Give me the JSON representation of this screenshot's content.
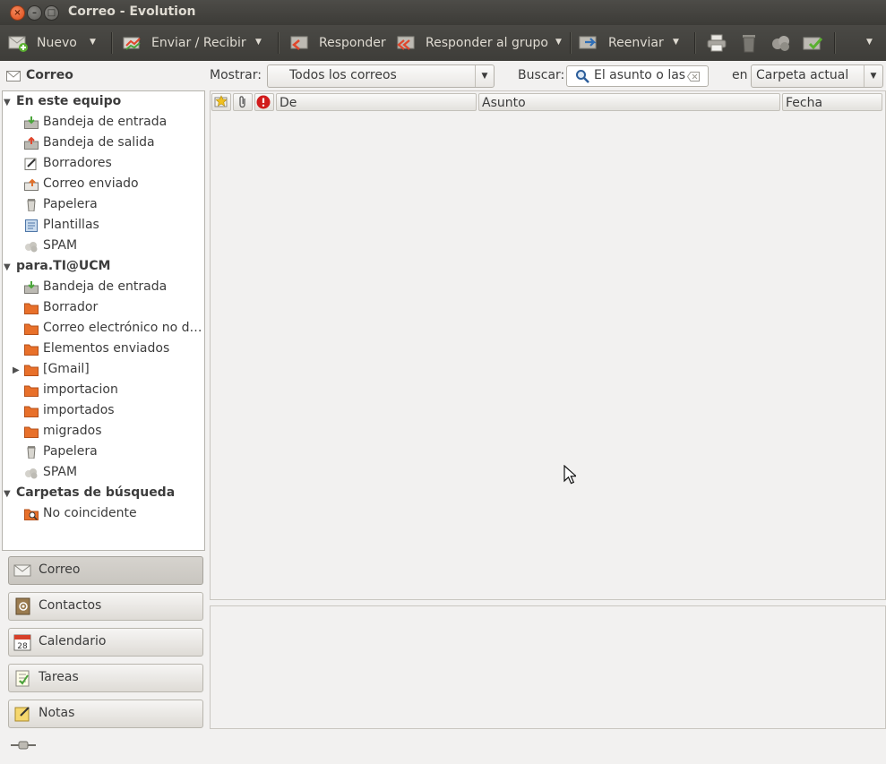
{
  "window": {
    "title": "Correo - Evolution"
  },
  "toolbar": {
    "new_label": "Nuevo",
    "send_receive_label": "Enviar / Recibir",
    "reply_label": "Responder",
    "reply_group_label": "Responder al grupo",
    "forward_label": "Reenviar"
  },
  "sidebar": {
    "header_title": "Correo",
    "groups": [
      {
        "name": "En este equipo",
        "folders": [
          "Bandeja de entrada",
          "Bandeja de salida",
          "Borradores",
          "Correo enviado",
          "Papelera",
          "Plantillas",
          "SPAM"
        ]
      },
      {
        "name": "para.TI@UCM",
        "folders": [
          "Bandeja de entrada",
          "Borrador",
          "Correo electrónico no d…",
          "Elementos enviados",
          "[Gmail]",
          "importacion",
          "importados",
          "migrados",
          "Papelera",
          "SPAM"
        ]
      },
      {
        "name": "Carpetas de búsqueda",
        "folders": [
          "No coincidente"
        ]
      }
    ]
  },
  "switcher": {
    "mail": "Correo",
    "contacts": "Contactos",
    "calendar": "Calendario",
    "calendar_day": "28",
    "tasks": "Tareas",
    "notes": "Notas"
  },
  "searchbar": {
    "show_label": "Mostrar:",
    "show_value": "Todos los correos",
    "search_label": "Buscar:",
    "search_placeholder": "El asunto o las",
    "in_label": "en",
    "scope_value": "Carpeta actual"
  },
  "message_list": {
    "columns": [
      "De",
      "Asunto",
      "Fecha"
    ]
  },
  "colors": {
    "titlebar": "#3c3b37",
    "close_button": "#df4a16",
    "folder_orange": "#e8702a",
    "background": "#f2f1f0"
  }
}
